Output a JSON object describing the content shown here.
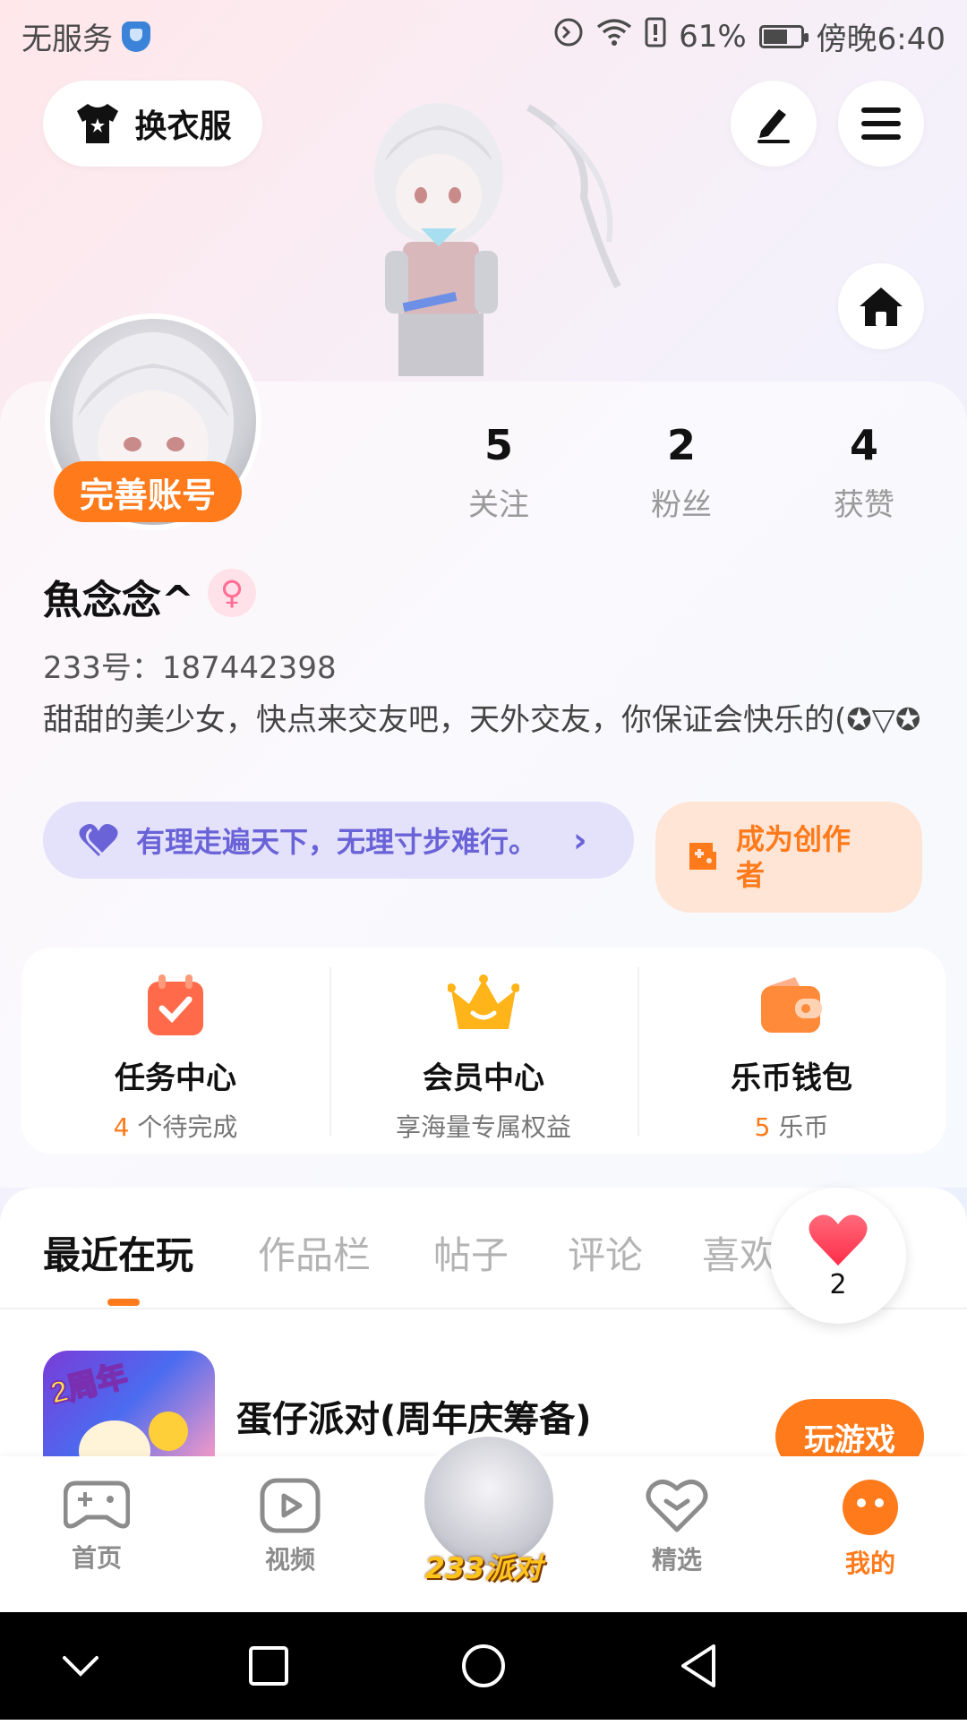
{
  "status_bar": {
    "carrier": "无服务",
    "battery": "61%",
    "time": "傍晚6:40"
  },
  "header": {
    "outfit_label": "换衣服"
  },
  "profile": {
    "complete_account_label": "完善账号",
    "stats": [
      {
        "value": "5",
        "label": "关注"
      },
      {
        "value": "2",
        "label": "粉丝"
      },
      {
        "value": "4",
        "label": "获赞"
      }
    ],
    "name": "魚念念^",
    "uid": "233号：187442398",
    "bio": "甜甜的美少女，快点来交友吧，天外交友，你保证会快乐的(✪▽✪",
    "motto": "有理走遍天下，无理寸步难行。",
    "creator_label": "成为创作者"
  },
  "services": [
    {
      "title": "任务中心",
      "highlight": "4",
      "subtitle": " 个待完成"
    },
    {
      "title": "会员中心",
      "highlight": "",
      "subtitle": "享海量专属权益"
    },
    {
      "title": "乐币钱包",
      "highlight": "5",
      "subtitle": " 乐币"
    }
  ],
  "tabs": [
    "最近在玩",
    "作品栏",
    "帖子",
    "评论",
    "喜欢"
  ],
  "likes_count": "2",
  "recent_game": {
    "title": "蛋仔派对(周年庆筹备)",
    "icon_badge": "2周年",
    "play_label": "玩游戏"
  },
  "bottom_nav": [
    {
      "label": "首页"
    },
    {
      "label": "视频"
    },
    {
      "label": "233派对"
    },
    {
      "label": "精选"
    },
    {
      "label": "我的"
    }
  ],
  "colors": {
    "accent": "#ff7a1a",
    "motto_text": "#6a63d8",
    "motto_bg": "#e4e1fa",
    "creator_bg": "#ffe5d6"
  }
}
